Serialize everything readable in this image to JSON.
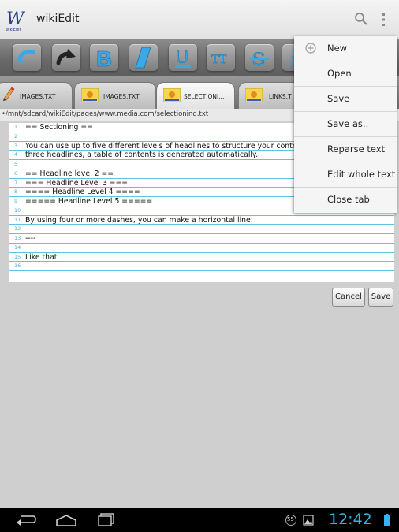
{
  "app": {
    "title": "wikiEdit",
    "logo_text": "wikiEdit",
    "logo_letter": "W"
  },
  "action_bar": {
    "search_icon": "search-icon",
    "overflow_icon": "overflow-menu-icon"
  },
  "toolbar": {
    "buttons": [
      {
        "name": "undo-icon"
      },
      {
        "name": "redo-icon"
      },
      {
        "name": "bold-icon",
        "glyph": "B"
      },
      {
        "name": "italic-icon"
      },
      {
        "name": "underline-icon",
        "glyph": "U"
      },
      {
        "name": "teletype-icon",
        "glyph": "TT"
      },
      {
        "name": "strikethrough-icon",
        "glyph": "S"
      },
      {
        "name": "extra-icon",
        "glyph": "x"
      }
    ],
    "accent": "#3aa8e6"
  },
  "tabs": [
    {
      "label": "IMAGES.TXT"
    },
    {
      "label": "IMAGES.TXT"
    },
    {
      "label": "SELECTIONI..."
    },
    {
      "label": "LINKS.T"
    }
  ],
  "path": "•/mnt/sdcard/wikiEdit/pages/www.media.com/selectioning.txt",
  "editor": {
    "lines": [
      {
        "n": "1",
        "text": "== Sectioning =="
      },
      {
        "n": "2",
        "text": ""
      },
      {
        "n": "3",
        "text": "You can use up to five different levels of headlines to structure your conte"
      },
      {
        "n": "4",
        "text": "three headlines, a table of contents is generated automatically."
      },
      {
        "n": "5",
        "text": ""
      },
      {
        "n": "6",
        "text": "== Headline level 2 =="
      },
      {
        "n": "7",
        "text": "=== Headline Level 3 ==="
      },
      {
        "n": "8",
        "text": "==== Headline Level 4 ===="
      },
      {
        "n": "9",
        "text": "===== Headline Level 5 ====="
      },
      {
        "n": "10",
        "text": ""
      },
      {
        "n": "11",
        "text": "By using four or more dashes, you can make a horizontal line:"
      },
      {
        "n": "12",
        "text": ""
      },
      {
        "n": "13",
        "text": "----"
      },
      {
        "n": "14",
        "text": ""
      },
      {
        "n": "15",
        "text": "Like that."
      },
      {
        "n": "16",
        "text": ""
      }
    ],
    "cancel_label": "Cancel",
    "save_label": "Save"
  },
  "menu": {
    "items": [
      {
        "label": "New",
        "icon": "add-circle-icon"
      },
      {
        "label": "Open"
      },
      {
        "label": "Save"
      },
      {
        "label": "Save as.."
      },
      {
        "label": "Reparse text"
      },
      {
        "label": "Edit whole text"
      },
      {
        "label": "Close tab"
      }
    ]
  },
  "status": {
    "time": "12:42",
    "notification_badge": "55"
  }
}
